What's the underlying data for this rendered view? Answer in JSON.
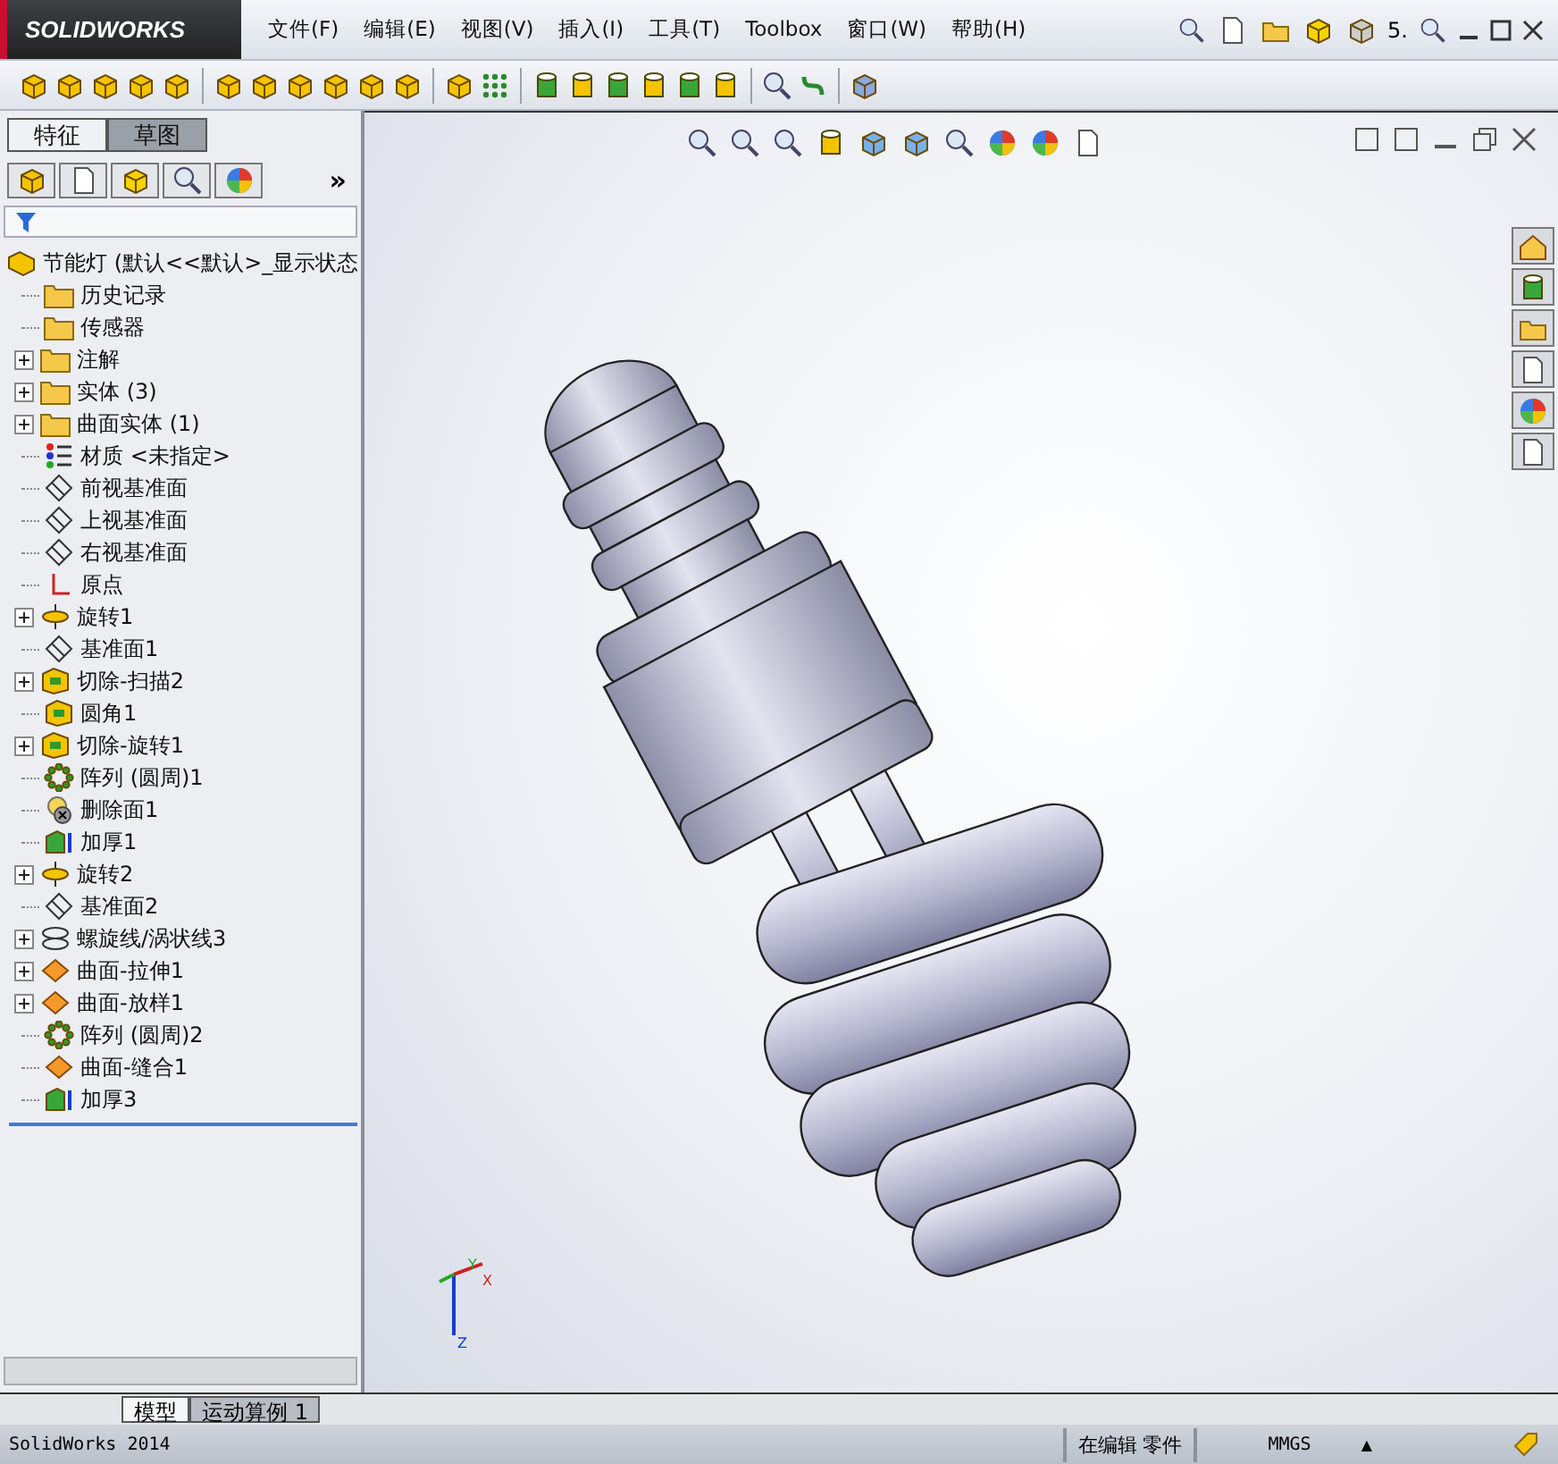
{
  "app": {
    "logo": "SOLIDWORKS"
  },
  "menu": [
    {
      "label": "文件(F)"
    },
    {
      "label": "编辑(E)"
    },
    {
      "label": "视图(V)"
    },
    {
      "label": "插入(I)"
    },
    {
      "label": "工具(T)"
    },
    {
      "label": "Toolbox"
    },
    {
      "label": "窗口(W)"
    },
    {
      "label": "帮助(H)"
    }
  ],
  "title_bar_extra": "5.",
  "panel_tabs": [
    {
      "label": "特征",
      "selected": true
    },
    {
      "label": "草图",
      "selected": false
    }
  ],
  "manager_more": "»",
  "tree": {
    "root": "节能灯  (默认<<默认>_显示状态",
    "items": [
      {
        "label": "历史记录",
        "kind": "folder",
        "expandable": false
      },
      {
        "label": "传感器",
        "kind": "folder",
        "expandable": false
      },
      {
        "label": "注解",
        "kind": "folder",
        "expandable": true
      },
      {
        "label": "实体 (3)",
        "kind": "folder",
        "expandable": true
      },
      {
        "label": "曲面实体 (1)",
        "kind": "folder",
        "expandable": true
      },
      {
        "label": "材质 <未指定>",
        "kind": "material",
        "expandable": false
      },
      {
        "label": "前视基准面",
        "kind": "plane",
        "expandable": false
      },
      {
        "label": "上视基准面",
        "kind": "plane",
        "expandable": false
      },
      {
        "label": "右视基准面",
        "kind": "plane",
        "expandable": false
      },
      {
        "label": "原点",
        "kind": "origin",
        "expandable": false
      },
      {
        "label": "旋转1",
        "kind": "revolve",
        "expandable": true
      },
      {
        "label": "基准面1",
        "kind": "plane",
        "expandable": false
      },
      {
        "label": "切除-扫描2",
        "kind": "feature",
        "expandable": true
      },
      {
        "label": "圆角1",
        "kind": "feature",
        "expandable": false
      },
      {
        "label": "切除-旋转1",
        "kind": "feature",
        "expandable": true
      },
      {
        "label": "阵列 (圆周)1",
        "kind": "pattern",
        "expandable": false
      },
      {
        "label": "删除面1",
        "kind": "delete",
        "expandable": false
      },
      {
        "label": "加厚1",
        "kind": "thicken",
        "expandable": false
      },
      {
        "label": "旋转2",
        "kind": "revolve",
        "expandable": true
      },
      {
        "label": "基准面2",
        "kind": "plane",
        "expandable": false
      },
      {
        "label": "螺旋线/涡状线3",
        "kind": "helix",
        "expandable": true
      },
      {
        "label": "曲面-拉伸1",
        "kind": "surface",
        "expandable": true
      },
      {
        "label": "曲面-放样1",
        "kind": "surface",
        "expandable": true
      },
      {
        "label": "阵列 (圆周)2",
        "kind": "pattern",
        "expandable": false
      },
      {
        "label": "曲面-缝合1",
        "kind": "surface",
        "expandable": false
      },
      {
        "label": "加厚3",
        "kind": "thicken",
        "expandable": false
      }
    ]
  },
  "bottom_tabs": [
    {
      "label": "模型",
      "selected": true
    },
    {
      "label": "运动算例 1",
      "selected": false
    }
  ],
  "triad": {
    "x": "X",
    "y": "Y",
    "z": "Z"
  },
  "status_bar": {
    "product": "SolidWorks 2014",
    "mode": "在编辑 零件",
    "units": "MMGS",
    "units_caret": "▲"
  }
}
